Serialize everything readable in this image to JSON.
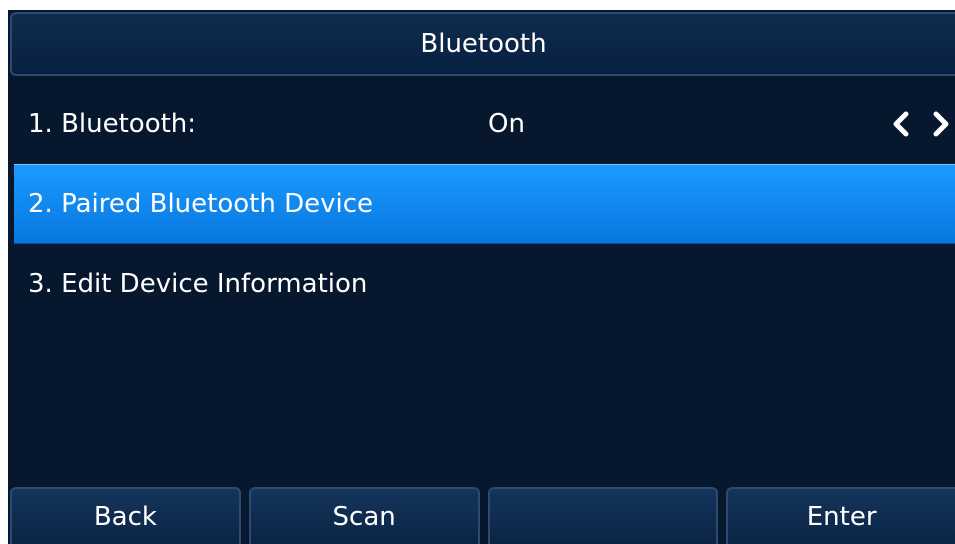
{
  "colors": {
    "background": "#07172d",
    "selected_row": "#1087f0",
    "text": "#ffffff"
  },
  "header": {
    "title": "Bluetooth"
  },
  "menu": {
    "items": [
      {
        "label": "1. Bluetooth:",
        "value": "On"
      },
      {
        "label": "2. Paired Bluetooth Device"
      },
      {
        "label": "3. Edit Device Information"
      }
    ],
    "selected_index": 1,
    "arrow_icons": [
      "chevron-left-icon",
      "chevron-right-icon"
    ]
  },
  "softkeys": [
    {
      "label": "Back"
    },
    {
      "label": "Scan"
    },
    {
      "label": ""
    },
    {
      "label": "Enter"
    }
  ]
}
